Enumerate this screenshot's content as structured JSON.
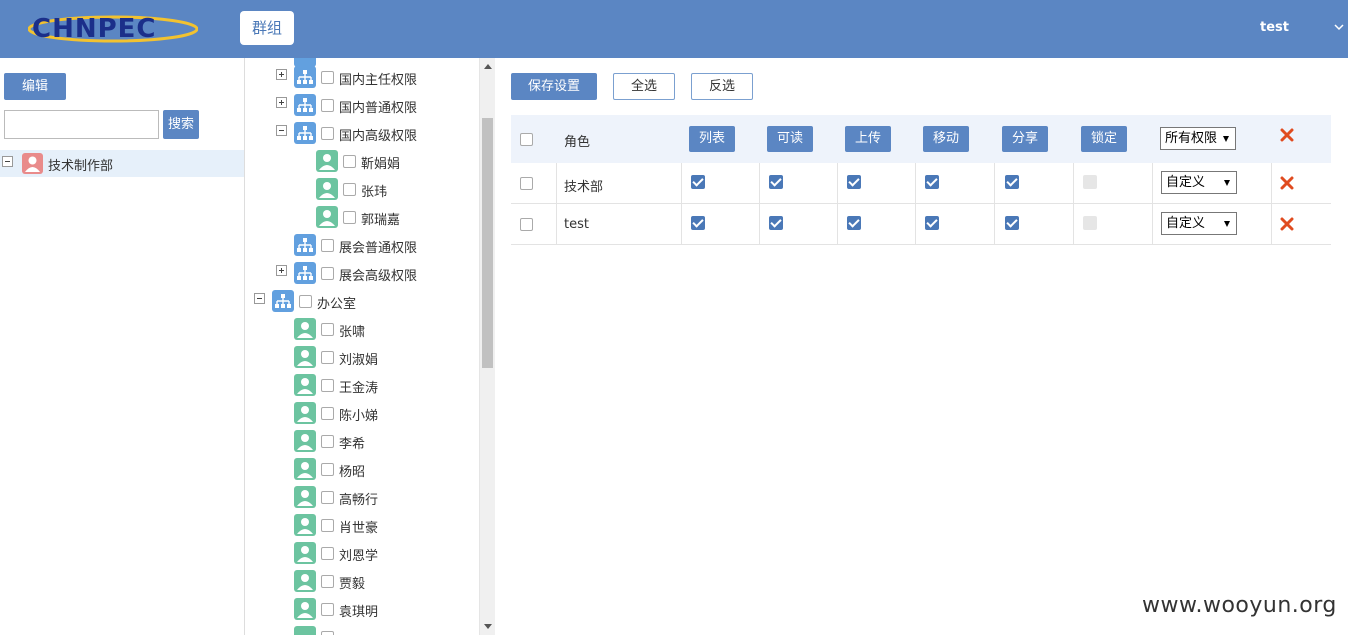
{
  "header": {
    "logo_text": "CHNPEC",
    "nav_tab": "群组",
    "user": "test"
  },
  "left": {
    "edit_label": "编辑",
    "search_placeholder": "",
    "search_label": "搜索",
    "department": "技术制作部"
  },
  "tree": {
    "items": [
      {
        "label": "国内主任权限",
        "type": "group",
        "toggle": "plus"
      },
      {
        "label": "国内普通权限",
        "type": "group",
        "toggle": "plus"
      },
      {
        "label": "国内高级权限",
        "type": "group",
        "toggle": "minus"
      },
      {
        "label": "靳娟娟",
        "type": "person"
      },
      {
        "label": "张玮",
        "type": "person"
      },
      {
        "label": "郭瑞嘉",
        "type": "person"
      },
      {
        "label": "展会普通权限",
        "type": "group"
      },
      {
        "label": "展会高级权限",
        "type": "group",
        "toggle": "plus"
      },
      {
        "label": "办公室",
        "type": "group",
        "toggle": "minus"
      },
      {
        "label": "张啸",
        "type": "person"
      },
      {
        "label": "刘淑娟",
        "type": "person"
      },
      {
        "label": "王金涛",
        "type": "person"
      },
      {
        "label": "陈小娣",
        "type": "person"
      },
      {
        "label": "李希",
        "type": "person"
      },
      {
        "label": "杨昭",
        "type": "person"
      },
      {
        "label": "高畅行",
        "type": "person"
      },
      {
        "label": "肖世豪",
        "type": "person"
      },
      {
        "label": "刘恩学",
        "type": "person"
      },
      {
        "label": "贾毅",
        "type": "person"
      },
      {
        "label": "袁琪明",
        "type": "person"
      }
    ]
  },
  "toolbar": {
    "save_label": "保存设置",
    "select_all_label": "全选",
    "invert_label": "反选"
  },
  "table": {
    "role_header": "角色",
    "columns": [
      "列表",
      "可读",
      "上传",
      "移动",
      "分享",
      "锁定"
    ],
    "all_select_value": "所有权限",
    "rows": [
      {
        "role": "技术部",
        "perms": [
          true,
          true,
          true,
          true,
          true,
          false
        ],
        "select_value": "自定义"
      },
      {
        "role": "test",
        "perms": [
          true,
          true,
          true,
          true,
          true,
          false
        ],
        "select_value": "自定义"
      }
    ]
  },
  "watermark": "www.wooyun.org",
  "colors": {
    "header_bg": "#5b86c3",
    "accent": "#4a78b7",
    "delete": "#e04b1f"
  }
}
